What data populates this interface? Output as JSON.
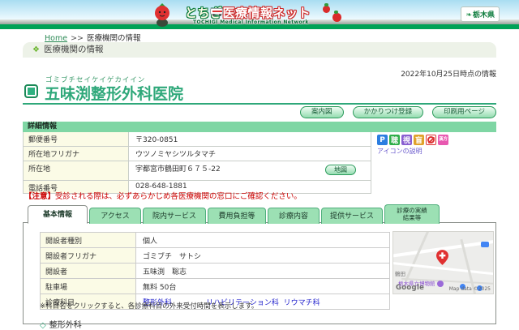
{
  "header": {
    "site_title_part1": "とちぎ",
    "site_title_part2": "医療情報ネット",
    "site_subtitle": "TOCHIGI Medical Information Network",
    "pref_logo_label": "栃木県",
    "pref_leaf_glyph": "❧"
  },
  "breadcrumb": {
    "home": "Home",
    "separator": ">>",
    "current": "医療機関の情報"
  },
  "section": {
    "diamond_glyph": "❖",
    "title": "医療機関の情報"
  },
  "info_date": "2022年10月25日時点の情報",
  "clinic": {
    "furigana": "ゴミブチセイケイゲカイイン",
    "name": "五味渕整形外科医院"
  },
  "action_buttons": [
    {
      "label": "案内図"
    },
    {
      "label": "かかりつけ登録"
    },
    {
      "label": "印刷用ページ"
    }
  ],
  "details": {
    "header": "詳細情報",
    "rows": [
      {
        "label": "郵便番号",
        "value": "〒320-0851"
      },
      {
        "label": "所在地フリガナ",
        "value": "ウツノミヤシツルタマチ"
      },
      {
        "label": "所在地",
        "value": "宇都宮市鶴田町６７５-22",
        "button": "地図"
      },
      {
        "label": "電話番号",
        "value": "028-648-1881"
      }
    ]
  },
  "facility_icons": {
    "legend_link": "アイコンの説明",
    "items": [
      {
        "name": "parking",
        "glyph": "P",
        "color": "#2b7de0"
      },
      {
        "name": "hearing-support",
        "glyph": "聴",
        "color": "#2fae4a"
      },
      {
        "name": "vision-support",
        "glyph": "視",
        "color": "#8a5fd0"
      },
      {
        "name": "guide-dog",
        "glyph": "盲",
        "color": "#e0a22b"
      },
      {
        "name": "no-smoking",
        "glyph": "禁煙",
        "color": "#dd3333"
      },
      {
        "name": "kampo",
        "glyph": "漢方",
        "color": "#e858b0"
      }
    ]
  },
  "notice": {
    "prefix": "【注意】",
    "text": "受診される際は、必ずあらかじめ各医療機関の窓口にご確認ください。"
  },
  "tabs": [
    {
      "label": "基本情報",
      "active": true
    },
    {
      "label": "アクセス"
    },
    {
      "label": "院内サービス"
    },
    {
      "label": "費用負担等"
    },
    {
      "label": "診療内容"
    },
    {
      "label": "提供サービス"
    },
    {
      "line1": "診療の実績",
      "line2": "結果等"
    }
  ],
  "basic_info": {
    "rows": [
      {
        "label": "開設者種別",
        "value": "個人"
      },
      {
        "label": "開設者フリガナ",
        "value": "ゴミブチ　サトシ"
      },
      {
        "label": "開設者",
        "value": "五味渕　聡志"
      },
      {
        "label": "駐車場",
        "value": "無料 50台"
      },
      {
        "label": "診療科目"
      }
    ],
    "departments": [
      "整形外科",
      "リハビリテーション科",
      "リウマチ科"
    ],
    "note": "※科目名をクリックすると、各診療科目の外来受付時間を表示します。",
    "section_diamond": "◇",
    "section_heading": "整形外科"
  },
  "map": {
    "poi_label": "栃木県立博物館",
    "area_label": "鶴田",
    "google_logo": "Google",
    "copyright": "Map data ©2025"
  },
  "theme": {
    "band_green": "#00a257",
    "accent_green": "#2fa87a",
    "tab_green": "#9ce0b4",
    "detail_bar_green": "#7fd6a4",
    "label_cell_bg": "#fbfbe6",
    "notice_red": "#cc0000",
    "link_blue": "#2222cc",
    "legend_purple": "#6a5acd",
    "pin_red": "#e03131"
  }
}
